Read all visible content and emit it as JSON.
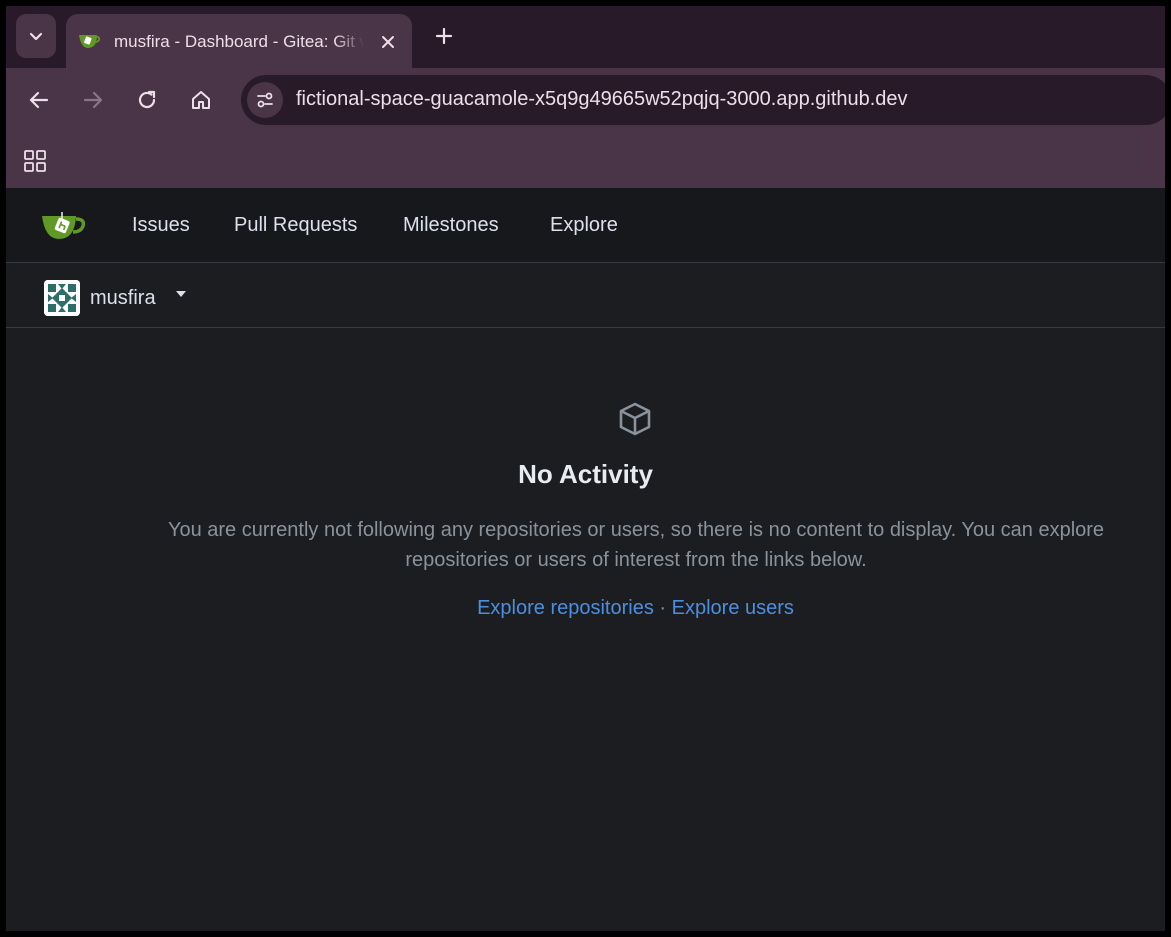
{
  "browser": {
    "tab_title": "musfira - Dashboard - Gitea: Git with a cup of tea",
    "url": "fictional-space-guacamole-x5q9g49665w52pqjq-3000.app.github.dev"
  },
  "navbar": {
    "items": [
      "Issues",
      "Pull Requests",
      "Milestones",
      "Explore"
    ]
  },
  "context": {
    "username": "musfira"
  },
  "empty_state": {
    "title": "No Activity",
    "description": "You are currently not following any repositories or users, so there is no content to display. You can explore repositories or users of interest from the links below.",
    "link_repos": "Explore repositories",
    "separator": "·",
    "link_users": "Explore users"
  },
  "colors": {
    "accent_link": "#4c8fe0",
    "gitea_green": "#609926",
    "chrome_tab": "#4a3447",
    "chrome_dark": "#291a29",
    "page_bg": "#1b1d21"
  },
  "icons": [
    "chevron-down-icon",
    "gitea-favicon",
    "close-icon",
    "plus-icon",
    "back-arrow-icon",
    "forward-arrow-icon",
    "reload-icon",
    "home-icon",
    "site-settings-icon",
    "apps-grid-icon",
    "gitea-logo",
    "caret-down-icon",
    "package-icon"
  ]
}
